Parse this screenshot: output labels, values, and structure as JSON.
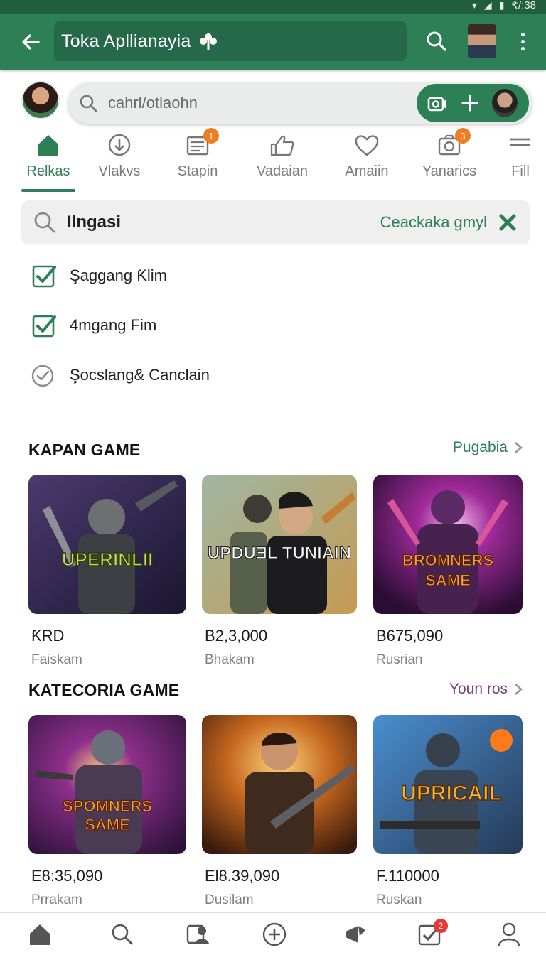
{
  "status_bar": {
    "time": "₹/:38"
  },
  "app_bar": {
    "title": "Toka Apllianayia",
    "title_icon": "flower-icon",
    "search_icon": "search-icon",
    "avatar": "profile-avatar",
    "more_icon": "more-vertical-icon"
  },
  "search": {
    "placeholder": "cahrl/otlaohn",
    "actions": [
      "camera-icon",
      "plus-icon",
      "avatar"
    ]
  },
  "tabs": [
    {
      "label": "Relkas",
      "icon": "home-icon",
      "active": true
    },
    {
      "label": "Vlakvs",
      "icon": "download-circle-icon"
    },
    {
      "label": "Stapin",
      "icon": "list-icon",
      "badge": "1"
    },
    {
      "label": "Vadaian",
      "icon": "thumbs-up-icon"
    },
    {
      "label": "Amaiin",
      "icon": "heart-icon"
    },
    {
      "label": "Yanarics",
      "icon": "camera-icon",
      "badge": "3"
    },
    {
      "label": "Fill",
      "icon": "menu-icon"
    }
  ],
  "filter": {
    "query": "Ilngasi",
    "clear_label": "Ceackaka gmyl"
  },
  "checklist": [
    {
      "label": "Şaggang Ƙlim",
      "checked": true
    },
    {
      "label": "4mgang Fim",
      "checked": true
    },
    {
      "label": "Şocslang& Canclain",
      "checked": false
    }
  ],
  "sections": [
    {
      "title": "KAPAN GAME",
      "link": "Pugabia",
      "link_color": "#2d8055",
      "cards": [
        {
          "art_text": "UPERINLII",
          "price": "ƘRD",
          "location": "Faiskam"
        },
        {
          "art_text": "UPDUƎL TUNIAIN",
          "price": "B2,3,000",
          "location": "Bhakam"
        },
        {
          "art_text": "BROMNERS SAME",
          "price": "B675,090",
          "location": "Rusrian"
        }
      ]
    },
    {
      "title": "KATECORIA GAME",
      "link": "Youn ros",
      "link_color": "#7a3f7c",
      "cards": [
        {
          "art_text": "SPOMNERS SAME",
          "price": "E8:35,090",
          "location": "Prrakam"
        },
        {
          "art_text": "",
          "price": "El8.39,090",
          "location": "Dusilam"
        },
        {
          "art_text": "UPRICAIL",
          "price": "F.110000",
          "location": "Ruskan"
        }
      ]
    }
  ],
  "bottom_nav": [
    {
      "icon": "home-icon"
    },
    {
      "icon": "search-icon"
    },
    {
      "icon": "users-icon"
    },
    {
      "icon": "add-circle-icon"
    },
    {
      "icon": "megaphone-icon"
    },
    {
      "icon": "checkbox-icon",
      "badge": "2"
    },
    {
      "icon": "profile-icon"
    }
  ],
  "colors": {
    "primary": "#2d8055",
    "primary_dark": "#25694a",
    "badge_orange": "#ef7d22",
    "badge_red": "#e53935"
  }
}
